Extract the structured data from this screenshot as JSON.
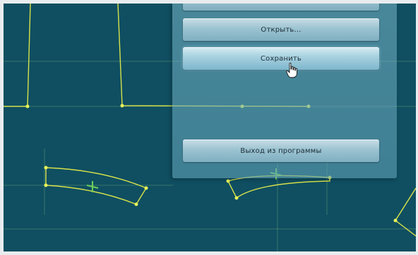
{
  "menu": {
    "top_button_label": "",
    "open_label": "Открыть...",
    "save_label": "Сохранить",
    "exit_label": "Выход из программы"
  },
  "colors": {
    "canvas_background": "#0f4f61",
    "pattern_line": "#d8e24a",
    "pattern_point": "#e8f25a",
    "guide_line": "#b8d86a"
  }
}
